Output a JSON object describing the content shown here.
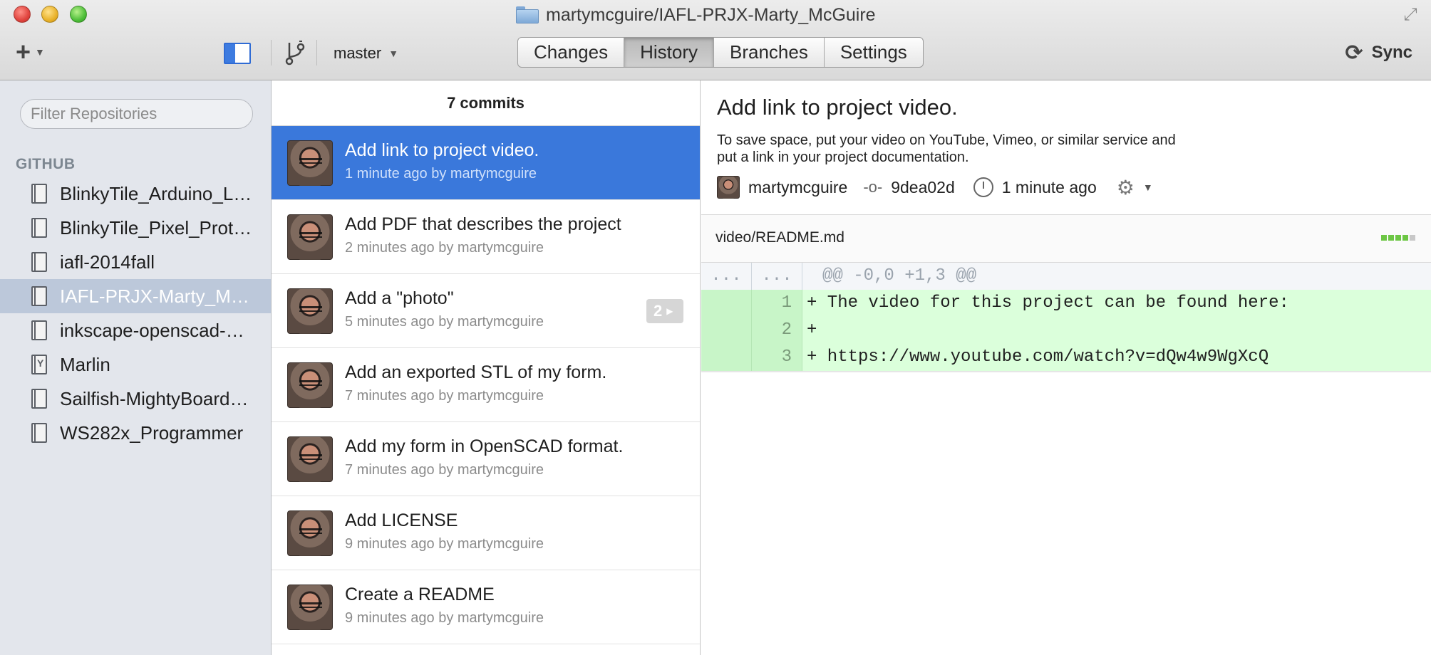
{
  "window": {
    "title": "martymcguire/IAFL-PRJX-Marty_McGuire"
  },
  "toolbar": {
    "branch": "master",
    "tabs": [
      "Changes",
      "History",
      "Branches",
      "Settings"
    ],
    "active_tab": "History",
    "sync_label": "Sync"
  },
  "sidebar": {
    "filter_placeholder": "Filter Repositories",
    "section_heading": "GITHUB",
    "repos": [
      {
        "name": "BlinkyTile_Arduino_Library",
        "type": "repo"
      },
      {
        "name": "BlinkyTile_Pixel_Protocol",
        "type": "repo"
      },
      {
        "name": "iafl-2014fall",
        "type": "repo"
      },
      {
        "name": "IAFL-PRJX-Marty_McGuire",
        "type": "repo",
        "selected": true
      },
      {
        "name": "inkscape-openscad-poly",
        "type": "repo"
      },
      {
        "name": "Marlin",
        "type": "fork"
      },
      {
        "name": "Sailfish-MightyBoardFirmware",
        "type": "repo"
      },
      {
        "name": "WS282x_Programmer",
        "type": "repo"
      }
    ]
  },
  "history": {
    "count_label": "7 commits",
    "commits": [
      {
        "title": "Add link to project video.",
        "meta": "1 minute ago by martymcguire",
        "selected": true
      },
      {
        "title": "Add PDF that describes the project",
        "meta": "2 minutes ago by martymcguire"
      },
      {
        "title": "Add a \"photo\"",
        "meta": "5 minutes ago by martymcguire",
        "badge": "2"
      },
      {
        "title": "Add an exported STL of my form.",
        "meta": "7 minutes ago by martymcguire"
      },
      {
        "title": "Add my form in OpenSCAD format.",
        "meta": "7 minutes ago by martymcguire"
      },
      {
        "title": "Add LICENSE",
        "meta": "9 minutes ago by martymcguire"
      },
      {
        "title": "Create a README",
        "meta": "9 minutes ago by martymcguire"
      }
    ]
  },
  "detail": {
    "title": "Add link to project video.",
    "description_line1": "To save space, put your video on YouTube, Vimeo, or similar service and",
    "description_line2": "put a link in your project documentation.",
    "author": "martymcguire",
    "sha": "9dea02d",
    "time": "1 minute ago",
    "file": "video/README.md",
    "diffstat": "5 additions",
    "hunk_header": "@@ -0,0 +1,3 @@",
    "hunk_old_ln": "...",
    "hunk_new_ln": "...",
    "lines": [
      {
        "ln": "1",
        "text": "+ The video for this project can be found here:"
      },
      {
        "ln": "2",
        "text": "+"
      },
      {
        "ln": "3",
        "text": "+ https://www.youtube.com/watch?v=dQw4w9WgXcQ"
      }
    ]
  },
  "icons": {
    "add": "plus-icon",
    "sidebar_toggle": "sidebar-toggle-icon",
    "branch": "branch-icon",
    "sync": "sync-icon",
    "gear": "gear-icon",
    "clock": "clock-icon",
    "commit_sha": "commit-icon",
    "repo": "book-icon",
    "fork": "fork-icon",
    "folder": "folder-icon"
  },
  "colors": {
    "accent": "#3a78db",
    "added_line": "#dbffdb",
    "sidebar_bg": "#e3e6ec",
    "sidebar_selected": "#bcc8da"
  }
}
